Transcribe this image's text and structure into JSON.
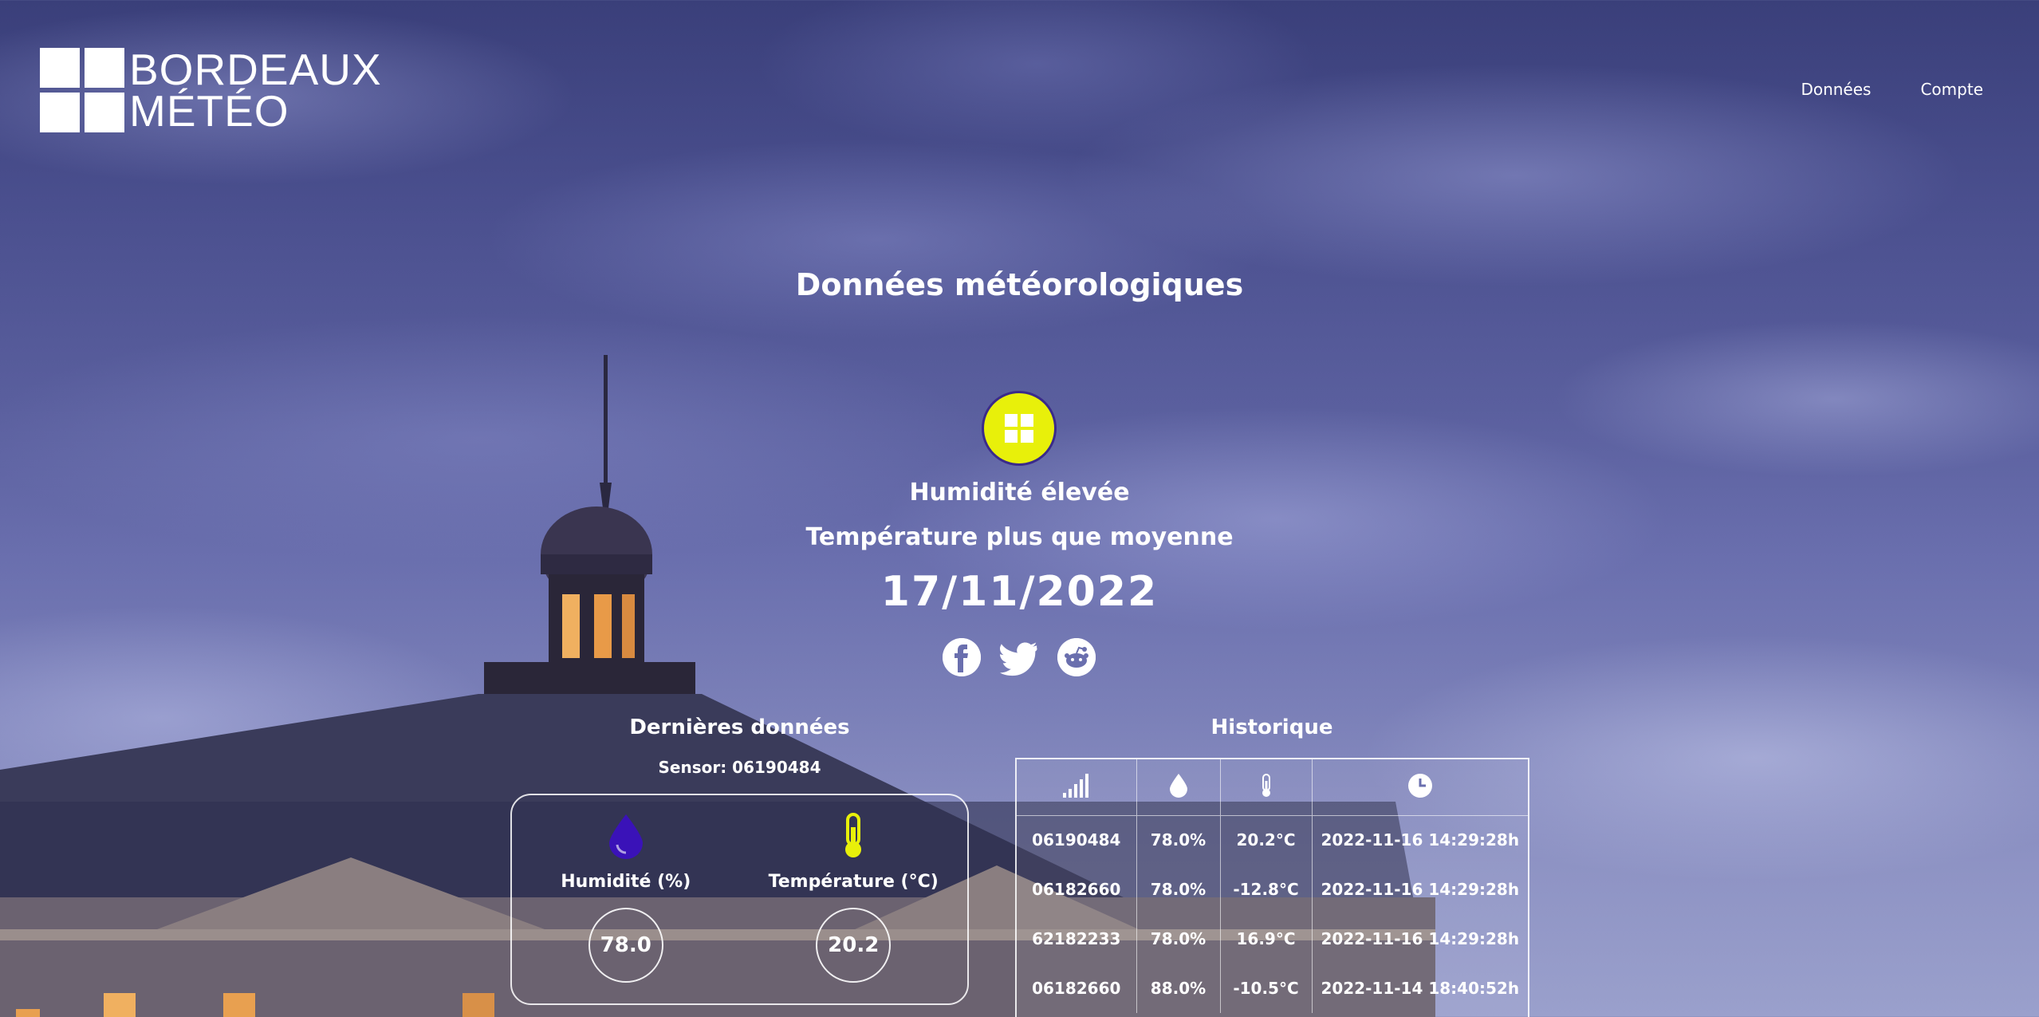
{
  "brand": {
    "line1": "BORDEAUX",
    "line2": "MÉTÉO"
  },
  "nav": {
    "data": "Données",
    "account": "Compte"
  },
  "main": {
    "title": "Données météorologiques",
    "status_line1": "Humidité élevée",
    "status_line2": "Température plus que moyenne",
    "date": "17/11/2022",
    "social": [
      "facebook-icon",
      "twitter-icon",
      "reddit-icon"
    ]
  },
  "latest": {
    "title": "Dernières données",
    "sensor": "Sensor: 06190484",
    "humidity": {
      "label": "Humidité (%)",
      "value": "78.0",
      "color": "#3a12b8"
    },
    "temperature": {
      "label": "Température (°C)",
      "value": "20.2",
      "color": "#e8f00a"
    }
  },
  "history": {
    "title": "Historique",
    "columns": [
      "signal-icon",
      "drop-icon",
      "thermometer-icon",
      "clock-icon"
    ],
    "rows": [
      [
        "06190484",
        "78.0%",
        "20.2°C",
        "2022-11-16 14:29:28h"
      ],
      [
        "06182660",
        "78.0%",
        "-12.8°C",
        "2022-11-16 14:29:28h"
      ],
      [
        "62182233",
        "78.0%",
        "16.9°C",
        "2022-11-16 14:29:28h"
      ],
      [
        "06182660",
        "88.0%",
        "-10.5°C",
        "2022-11-14 18:40:52h"
      ]
    ]
  },
  "colors": {
    "accent": "#e8f00a",
    "badge_border": "#3a2a8a"
  }
}
